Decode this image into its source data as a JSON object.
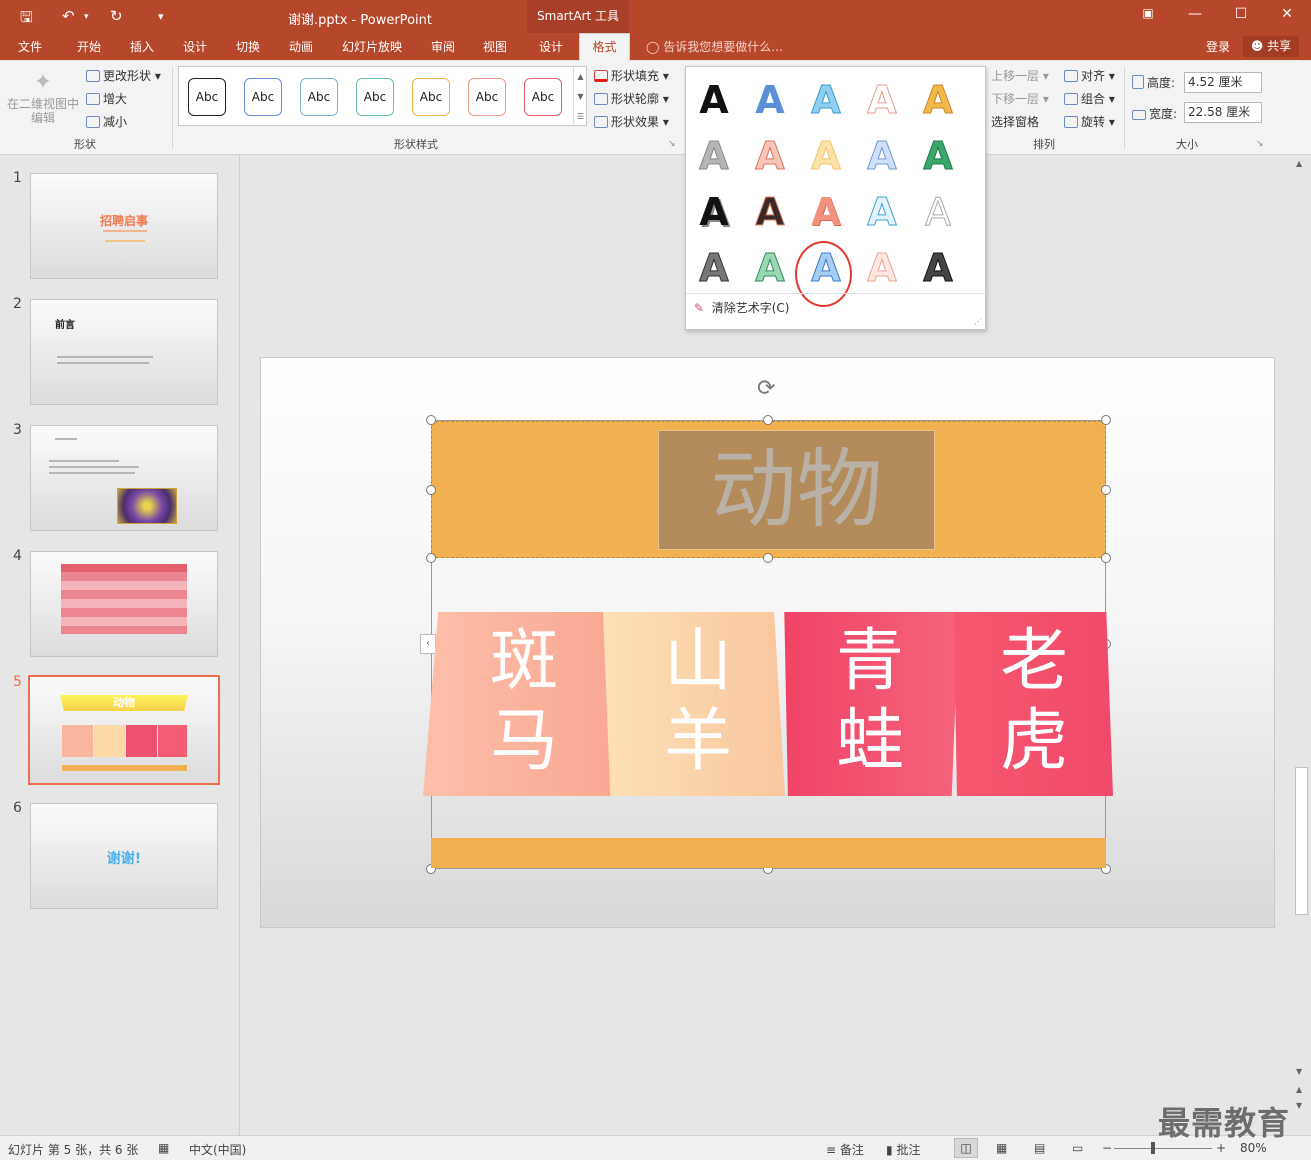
{
  "titlebar": {
    "doc_title": "谢谢.pptx - PowerPoint",
    "context_tab": "SmartArt 工具",
    "save_icon": "save-icon",
    "undo_icon": "undo-icon",
    "redo_icon": "redo-icon"
  },
  "tabs": [
    {
      "label": "文件"
    },
    {
      "label": "开始"
    },
    {
      "label": "插入"
    },
    {
      "label": "设计"
    },
    {
      "label": "切换"
    },
    {
      "label": "动画"
    },
    {
      "label": "幻灯片放映"
    },
    {
      "label": "审阅"
    },
    {
      "label": "视图"
    },
    {
      "label": "设计"
    },
    {
      "label": "格式"
    }
  ],
  "tellme": "告诉我您想要做什么...",
  "login": "登录",
  "share": "共享",
  "ribbon": {
    "shape_group": {
      "label": "形状",
      "edit_2d": "在二维视图中编辑",
      "change_shape": "更改形状",
      "larger": "增大",
      "smaller": "减小"
    },
    "styles_group": {
      "label": "形状样式",
      "abc": "Abc",
      "fill": "形状填充",
      "outline": "形状轮廓",
      "effects": "形状效果"
    },
    "arrange_group": {
      "label": "排列",
      "bring_forward": "上移一层",
      "send_backward": "下移一层",
      "selection_pane": "选择窗格",
      "align": "对齐",
      "group": "组合",
      "rotate": "旋转"
    },
    "size_group": {
      "label": "大小",
      "height_label": "高度:",
      "height_value": "4.52 厘米",
      "width_label": "宽度:",
      "width_value": "22.58 厘米"
    }
  },
  "wordart": {
    "glyph": "A",
    "clear_label": "清除艺术字(C)"
  },
  "thumbs": {
    "numbers": [
      "1",
      "2",
      "3",
      "4",
      "5",
      "6"
    ],
    "s1_title": "招聘启事",
    "s2_title": "前言",
    "s5_title": "动物",
    "s6_title": "谢谢!"
  },
  "slide": {
    "title": "动物",
    "cards": [
      {
        "text": "斑马"
      },
      {
        "text": "山羊"
      },
      {
        "text": "青蛙"
      },
      {
        "text": "老虎"
      }
    ]
  },
  "status": {
    "slide_info": "幻灯片 第 5 张，共 6 张",
    "language": "中文(中国)",
    "notes": "备注",
    "comments": "批注",
    "zoom": "80%"
  },
  "watermark": "最需教育",
  "colors": {
    "brand": "#b7472a",
    "title_band": "#f2b150",
    "highlight_circle": "#e03a2f"
  }
}
